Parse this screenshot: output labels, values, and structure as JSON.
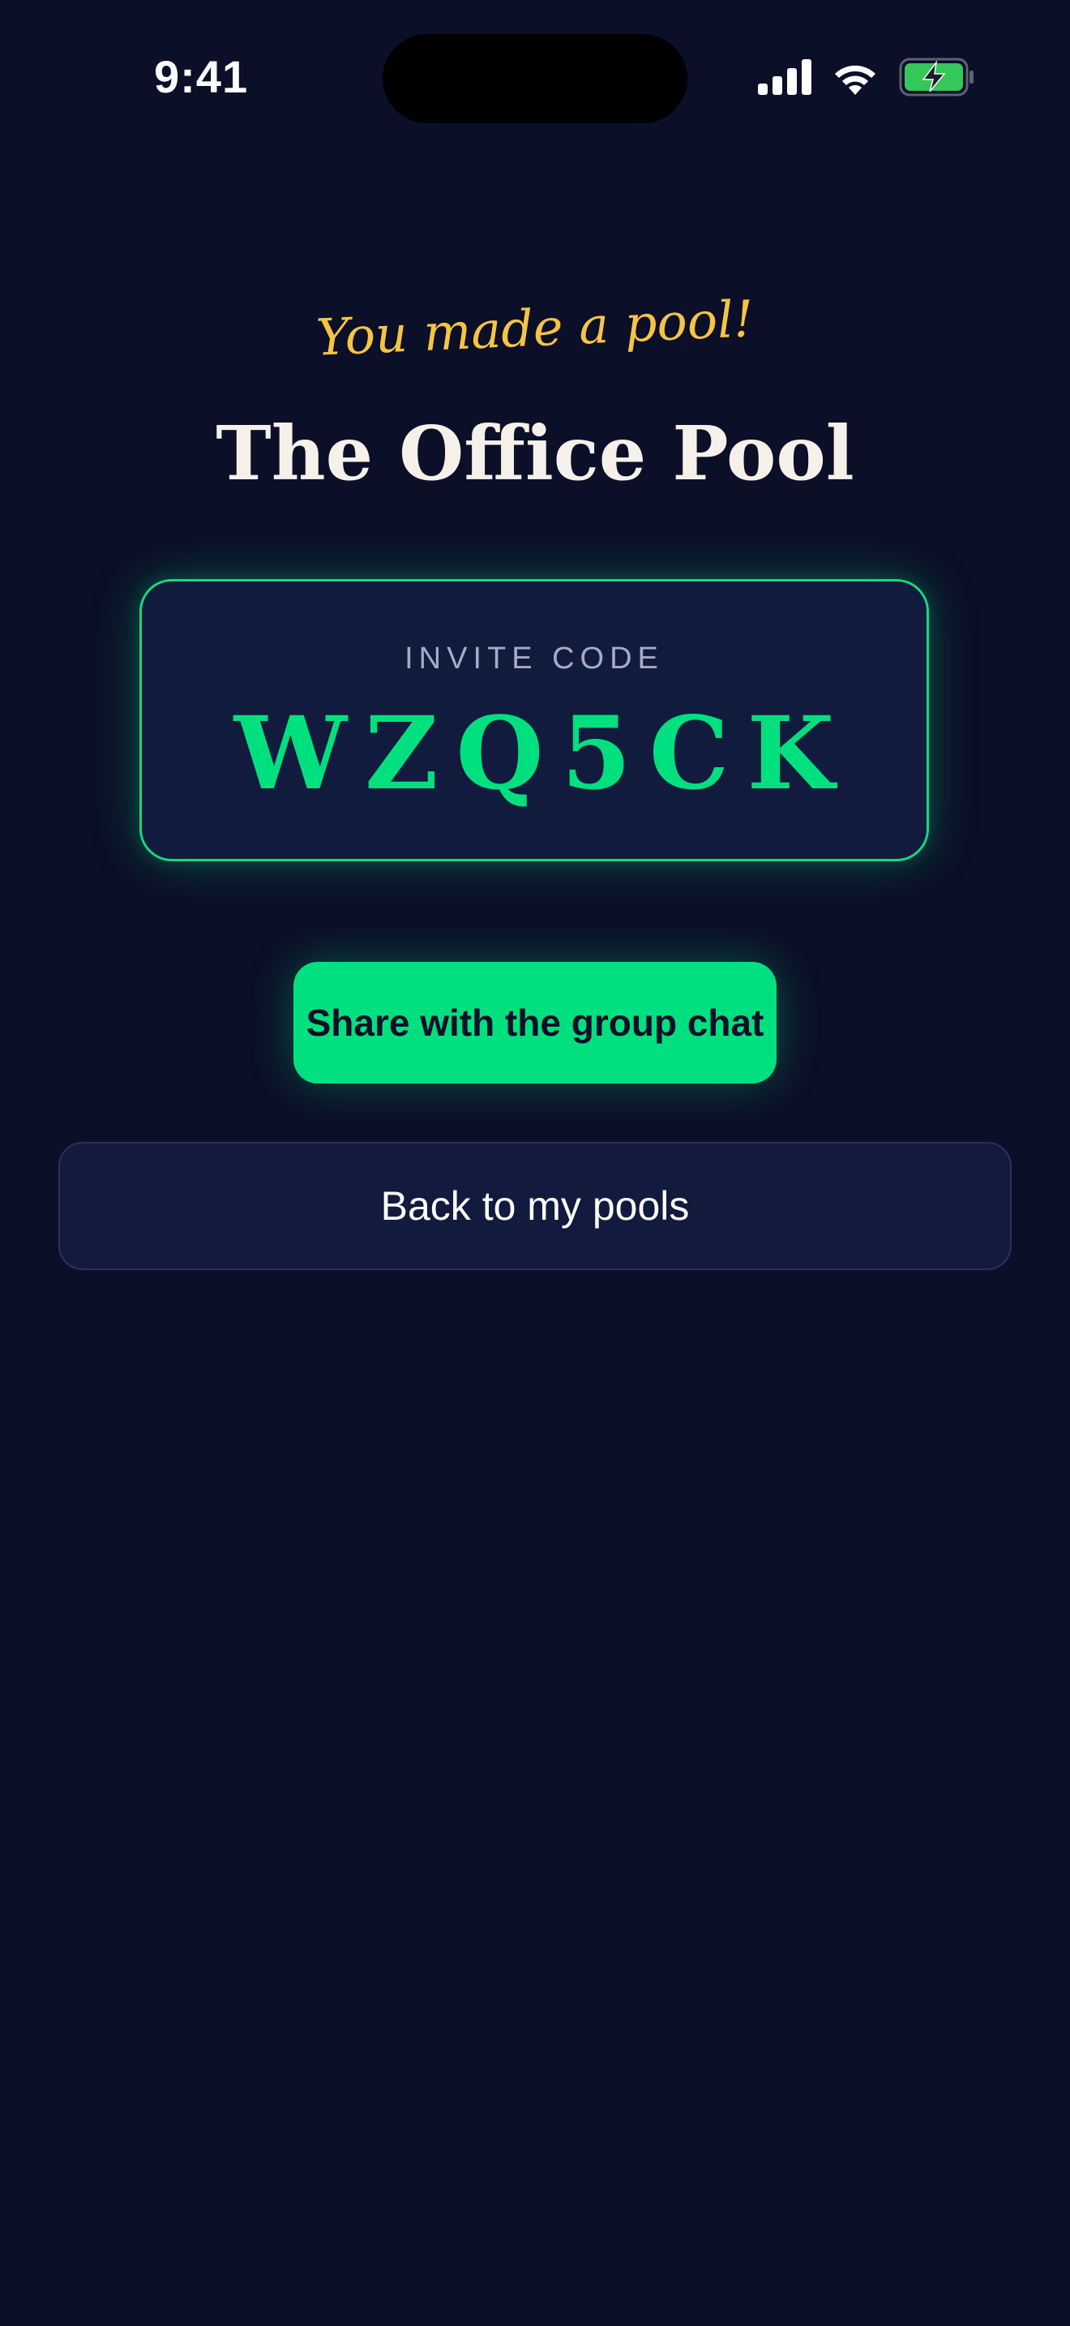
{
  "status_bar": {
    "time": "9:41",
    "icons": [
      "cellular-signal-icon",
      "wifi-icon",
      "battery-charging-icon"
    ]
  },
  "header": {
    "tagline": "You made a pool!",
    "pool_name": "The Office Pool"
  },
  "invite": {
    "label": "INVITE CODE",
    "code": "WZQ5CK"
  },
  "actions": {
    "share_label": "Share with the group chat",
    "back_label": "Back to my pools"
  },
  "colors": {
    "background": "#0b0f28",
    "accent_green": "#00e07f",
    "tagline_yellow": "#f6c445",
    "card_background": "#111b3d",
    "title_text": "#f5f1ea"
  }
}
